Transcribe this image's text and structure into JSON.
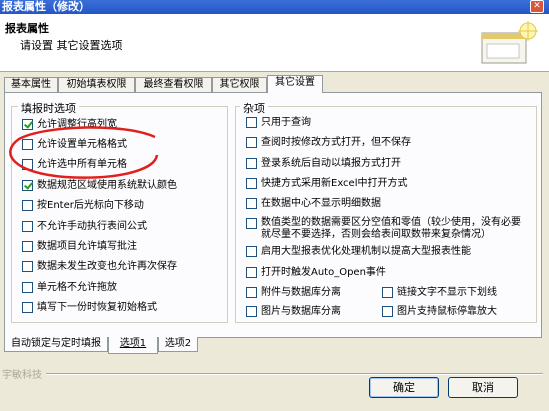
{
  "window": {
    "title": "报表属性（修改）"
  },
  "header": {
    "title": "报表属性",
    "subtitle": "请设置  其它设置选项"
  },
  "tabs": [
    "基本属性",
    "初始填表权限",
    "最终查看权限",
    "其它权限",
    "其它设置"
  ],
  "active_tab": 4,
  "fill_group": {
    "legend": "填报时选项",
    "items": [
      {
        "label": "允许调整行高列宽",
        "checked": true
      },
      {
        "label": "允许设置单元格格式",
        "checked": false
      },
      {
        "label": "允许选中所有单元格",
        "checked": false
      },
      {
        "label": "数据规范区域使用系统默认颜色",
        "checked": true
      },
      {
        "label": "按Enter后光标向下移动",
        "checked": false
      },
      {
        "label": "不允许手动执行表间公式",
        "checked": false
      },
      {
        "label": "数据项目允许填写批注",
        "checked": false
      },
      {
        "label": "数据未发生改变也允许再次保存",
        "checked": false
      },
      {
        "label": "单元格不允许拖放",
        "checked": false
      },
      {
        "label": "填写下一份时恢复初始格式",
        "checked": false
      }
    ]
  },
  "misc_group": {
    "legend": "杂项",
    "items": [
      {
        "label": "只用于查询",
        "checked": false
      },
      {
        "label": "查阅时按修改方式打开，但不保存",
        "checked": false
      },
      {
        "label": "登录系统后自动以填报方式打开",
        "checked": false
      },
      {
        "label": "快捷方式采用新Excel中打开方式",
        "checked": false
      },
      {
        "label": "在数据中心不显示明细数据",
        "checked": false
      },
      {
        "label": "数值类型的数据需要区分空值和零值（较少使用，没有必要就尽量不要选择，否则会给表间取数带来复杂情况）",
        "checked": false
      },
      {
        "label": "启用大型报表优化处理机制以提高大型报表性能",
        "checked": false
      },
      {
        "label": "打开时触发Auto_Open事件",
        "checked": false
      },
      {
        "label": "附件与数据库分离",
        "checked": false
      },
      {
        "label": "链接文字不显示下划线",
        "checked": false
      },
      {
        "label": "图片与数据库分离",
        "checked": false
      },
      {
        "label": "图片支持鼠标停靠放大",
        "checked": false
      }
    ]
  },
  "bottom_tabs": [
    "自动锁定与定时填报",
    "选项1",
    "选项2"
  ],
  "bottom_active": 1,
  "footer": {
    "company": "宇敏科技",
    "ok": "确定",
    "cancel": "取消"
  },
  "colors": {
    "annotation_circle": "#e0201c",
    "title_bar": "#2456c8"
  }
}
